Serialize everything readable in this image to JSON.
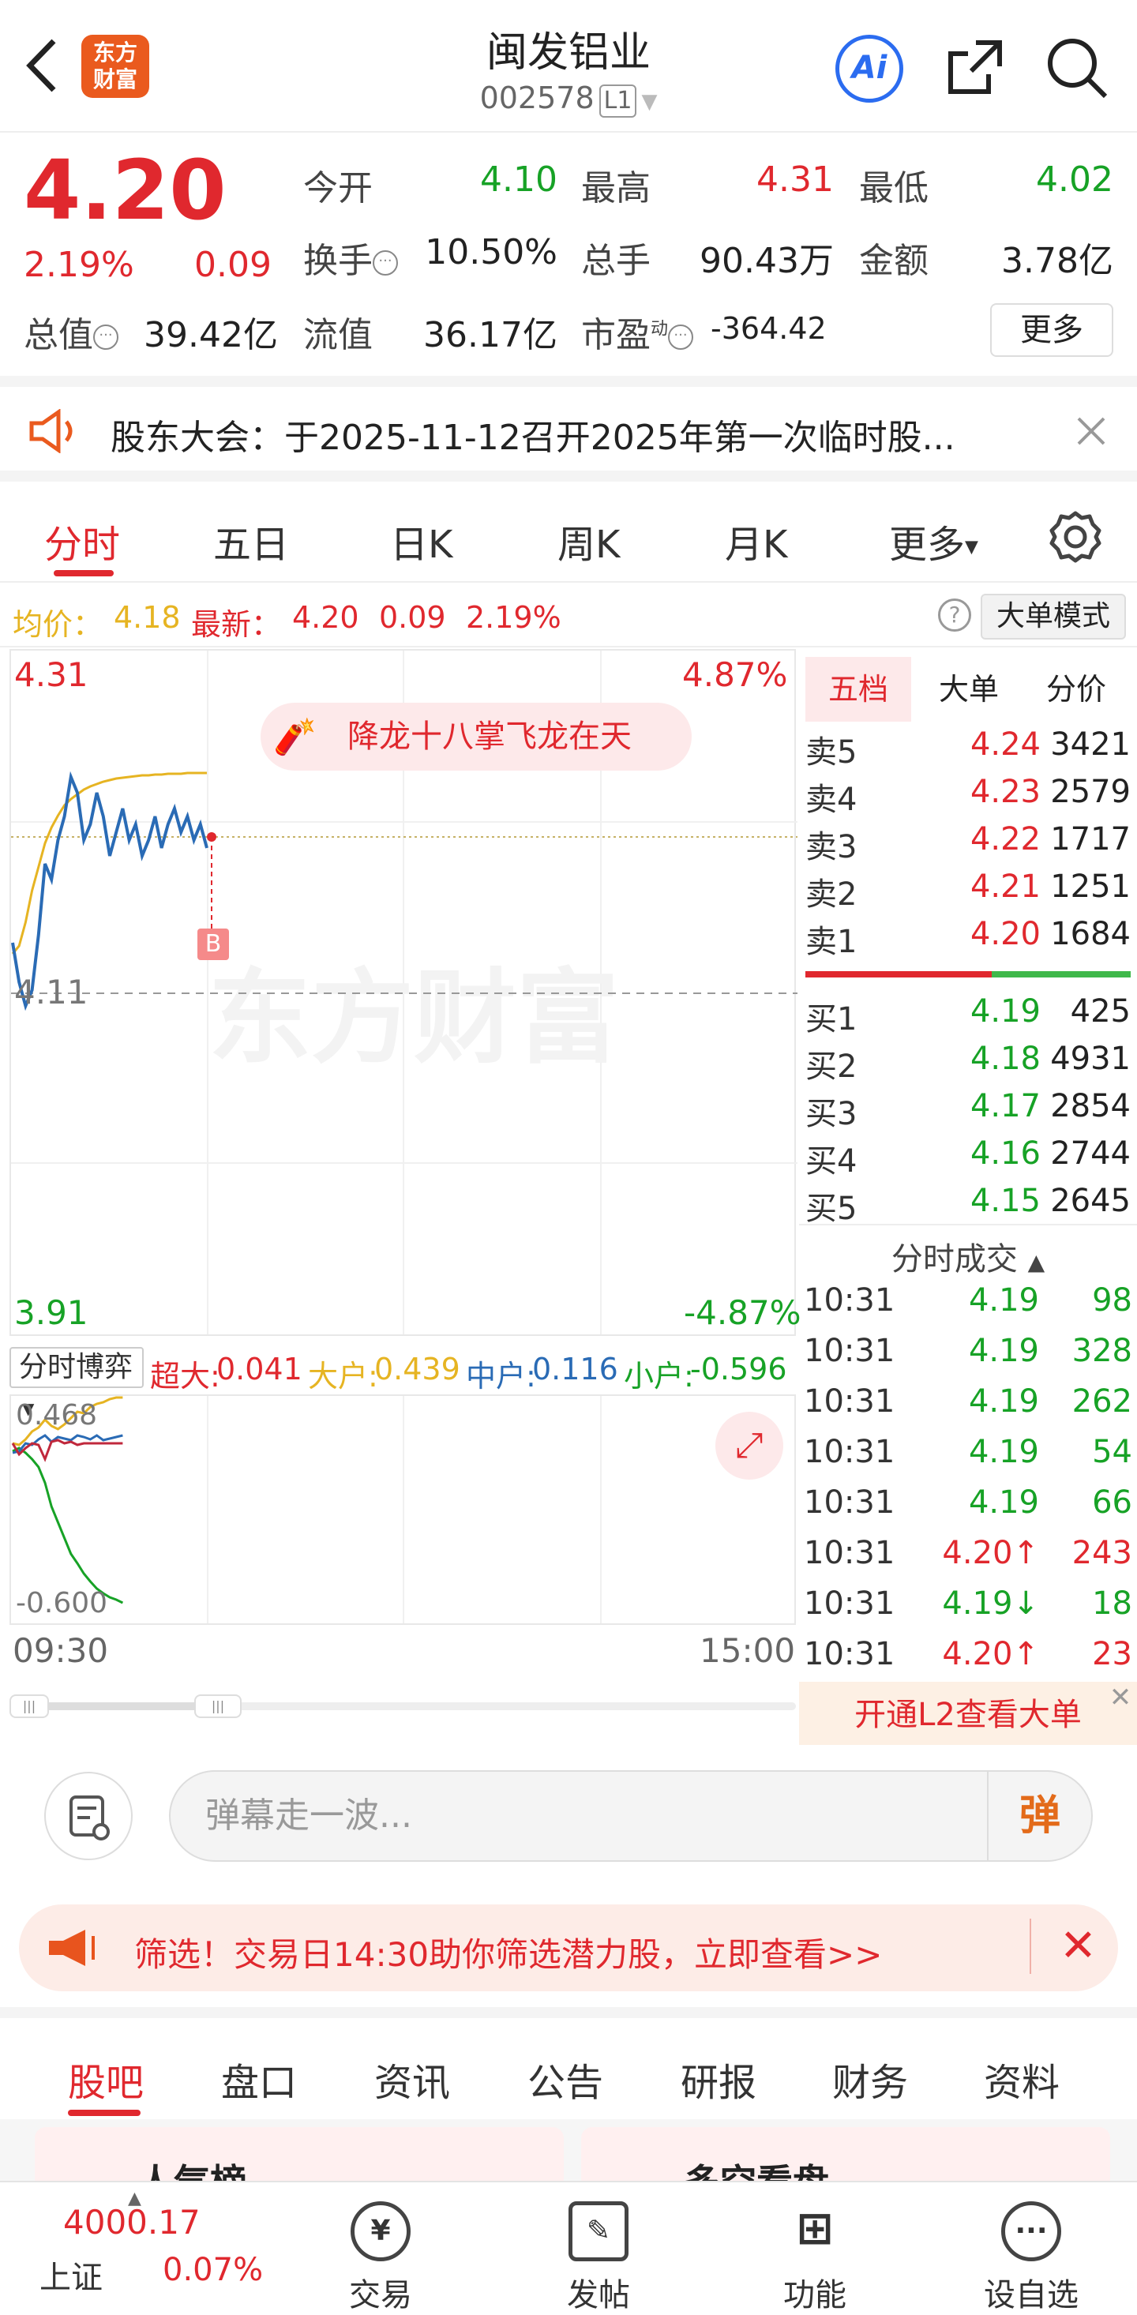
{
  "header": {
    "back_icon": "chevron-left",
    "logo_text": "东方\n财富",
    "title": "闽发铝业",
    "code": "002578",
    "level_badge": "L1",
    "ai_label": "Ai",
    "share_icon": "share-icon",
    "search_icon": "search-icon"
  },
  "quote": {
    "price": "4.20",
    "change_pct": "2.19%",
    "change": "0.09",
    "open_label": "今开",
    "open": "4.10",
    "high_label": "最高",
    "high": "4.31",
    "low_label": "最低",
    "low": "4.02",
    "turnover_label": "换手",
    "turnover": "10.50%",
    "volume_label": "总手",
    "volume": "90.43万",
    "amount_label": "金额",
    "amount": "3.78亿",
    "mktcap_label": "总值",
    "mktcap": "39.42亿",
    "float_label": "流值",
    "float": "36.17亿",
    "pe_label": "市盈",
    "pe_sup": "动",
    "pe": "-364.42",
    "more_label": "更多"
  },
  "notice": {
    "text": "股东大会：于2025-11-12召开2025年第一次临时股..."
  },
  "tabs": [
    "分时",
    "五日",
    "日K",
    "周K",
    "月K",
    "更多"
  ],
  "avg_bar": {
    "avg_label": "均价：",
    "avg_value": "4.18",
    "latest_label": "最新：",
    "latest_value": "4.20",
    "latest_change": "0.09",
    "latest_pct": "2.19%",
    "mode_button": "大单模式"
  },
  "chart": {
    "watermark": "东方财富",
    "banner": "降龙十八掌飞龙在天",
    "price_high": "4.31",
    "price_mid": "4.11",
    "price_low": "3.91",
    "pct_high": "4.87%",
    "pct_low": "-4.87%",
    "marker": "B"
  },
  "play": {
    "select": "分时博弈",
    "super_label": "超大:",
    "super": "0.041",
    "large_label": "大户:",
    "large": "0.439",
    "mid_label": "中户:",
    "mid": "0.116",
    "small_label": "小户:",
    "small": "-0.596"
  },
  "sub_chart": {
    "top": "0.468",
    "bottom": "-0.600"
  },
  "time_axis": {
    "start": "09:30",
    "end": "15:00"
  },
  "right_tabs": [
    "五档",
    "大单",
    "分价"
  ],
  "asks": [
    {
      "label": "卖5",
      "price": "4.24",
      "vol": "3421"
    },
    {
      "label": "卖4",
      "price": "4.23",
      "vol": "2579"
    },
    {
      "label": "卖3",
      "price": "4.22",
      "vol": "1717"
    },
    {
      "label": "卖2",
      "price": "4.21",
      "vol": "1251"
    },
    {
      "label": "卖1",
      "price": "4.20",
      "vol": "1684"
    }
  ],
  "bids": [
    {
      "label": "买1",
      "price": "4.19",
      "vol": "425"
    },
    {
      "label": "买2",
      "price": "4.18",
      "vol": "4931"
    },
    {
      "label": "买3",
      "price": "4.17",
      "vol": "2854"
    },
    {
      "label": "买4",
      "price": "4.16",
      "vol": "2744"
    },
    {
      "label": "买5",
      "price": "4.15",
      "vol": "2645"
    }
  ],
  "trades_title": "分时成交",
  "trades": [
    {
      "time": "10:31",
      "price": "4.19",
      "vol": "98",
      "dir": ""
    },
    {
      "time": "10:31",
      "price": "4.19",
      "vol": "328",
      "dir": ""
    },
    {
      "time": "10:31",
      "price": "4.19",
      "vol": "262",
      "dir": ""
    },
    {
      "time": "10:31",
      "price": "4.19",
      "vol": "54",
      "dir": ""
    },
    {
      "time": "10:31",
      "price": "4.19",
      "vol": "66",
      "dir": ""
    },
    {
      "time": "10:31",
      "price": "4.20",
      "vol": "243",
      "dir": "↑"
    },
    {
      "time": "10:31",
      "price": "4.19",
      "vol": "18",
      "dir": "↓"
    },
    {
      "time": "10:31",
      "price": "4.20",
      "vol": "23",
      "dir": "↑"
    }
  ],
  "l2_banner": "开通L2查看大单",
  "comment": {
    "placeholder": "弹幕走一波...",
    "dan_label": "弹"
  },
  "ad": {
    "text": "筛选！交易日14:30助你筛选潜力股，立即查看>>"
  },
  "bottom_tabs": [
    "股吧",
    "盘口",
    "资讯",
    "公告",
    "研报",
    "财务",
    "资料"
  ],
  "cards": [
    "人气榜",
    "多空看盘"
  ],
  "bottom_nav": {
    "index_value": "4000.17",
    "index_name": "上证",
    "index_pct": "0.07%",
    "items": [
      "交易",
      "发帖",
      "功能",
      "设自选"
    ]
  },
  "colors": {
    "up": "#e0282e",
    "down": "#17a226",
    "avg_line": "#e6b422",
    "price_line": "#2a6bb5",
    "accent": "#ea5a1e"
  }
}
